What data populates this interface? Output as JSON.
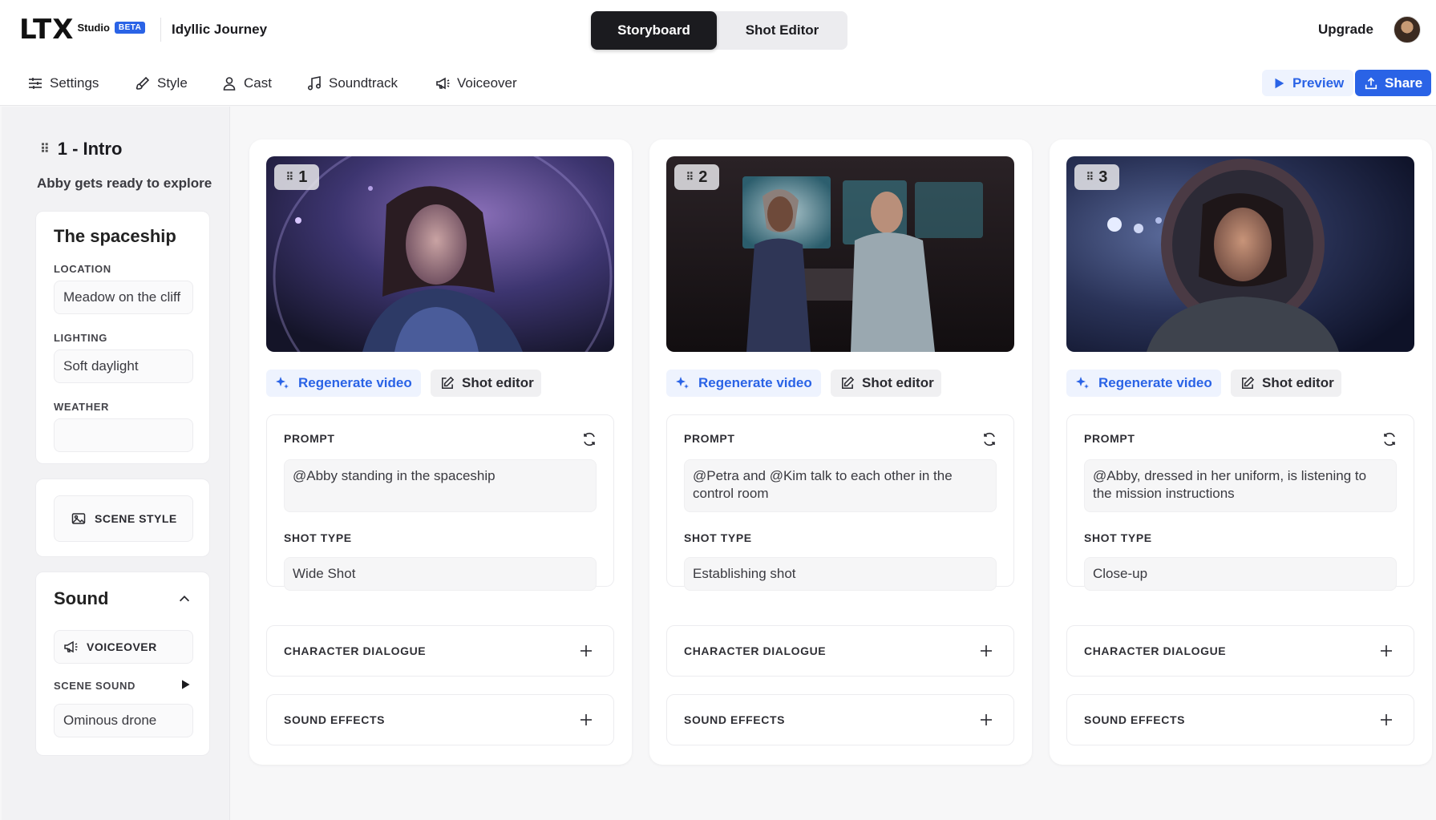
{
  "app": {
    "logo_mark": "LTX",
    "logo_studio": "Studio",
    "logo_beta": "BETA",
    "project_title": "Idyllic Journey"
  },
  "header": {
    "tabs": [
      {
        "label": "Storyboard",
        "active": true
      },
      {
        "label": "Shot Editor",
        "active": false
      }
    ],
    "upgrade_label": "Upgrade"
  },
  "toolbar": {
    "items": [
      {
        "label": "Settings",
        "icon": "sliders-icon"
      },
      {
        "label": "Style",
        "icon": "brush-icon"
      },
      {
        "label": "Cast",
        "icon": "user-icon"
      },
      {
        "label": "Soundtrack",
        "icon": "music-note-icon"
      },
      {
        "label": "Voiceover",
        "icon": "megaphone-icon"
      }
    ],
    "preview_label": "Preview",
    "share_label": "Share"
  },
  "scene": {
    "number": "1",
    "name": "Intro",
    "title": "1 - Intro",
    "subtitle": "Abby gets ready to explore",
    "settings": {
      "title": "The spaceship",
      "location_label": "LOCATION",
      "location_value": "Meadow on the cliff",
      "lighting_label": "LIGHTING",
      "lighting_value": "Soft daylight",
      "weather_label": "WEATHER",
      "weather_value": ""
    },
    "scene_style_label": "SCENE STYLE",
    "sound": {
      "title": "Sound",
      "voiceover_label": "VOICEOVER",
      "scene_sound_label": "SCENE SOUND",
      "scene_sound_value": "Ominous drone"
    }
  },
  "shots": [
    {
      "number": "1",
      "regenerate_label": "Regenerate video",
      "shot_editor_label": "Shot editor",
      "prompt_label": "PROMPT",
      "prompt_text": "@Abby standing in the spaceship",
      "shot_type_label": "SHOT TYPE",
      "shot_type_value": "Wide Shot",
      "dialogue_label": "CHARACTER DIALOGUE",
      "sfx_label": "SOUND EFFECTS"
    },
    {
      "number": "2",
      "regenerate_label": "Regenerate video",
      "shot_editor_label": "Shot editor",
      "prompt_label": "PROMPT",
      "prompt_text": "@Petra and @Kim talk to each other in the control room",
      "shot_type_label": "SHOT TYPE",
      "shot_type_value": "Establishing shot",
      "dialogue_label": "CHARACTER DIALOGUE",
      "sfx_label": "SOUND EFFECTS"
    },
    {
      "number": "3",
      "regenerate_label": "Regenerate video",
      "shot_editor_label": "Shot editor",
      "prompt_label": "PROMPT",
      "prompt_text": "@Abby, dressed in her uniform, is listening to the mission instructions",
      "shot_type_label": "SHOT TYPE",
      "shot_type_value": "Close-up",
      "dialogue_label": "CHARACTER DIALOGUE",
      "sfx_label": "SOUND EFFECTS"
    }
  ],
  "colors": {
    "accent": "#2a63e6",
    "accent_soft": "#eef3fe",
    "dark_tab": "#1b1b1f",
    "panel_bg": "#f2f2f4"
  }
}
